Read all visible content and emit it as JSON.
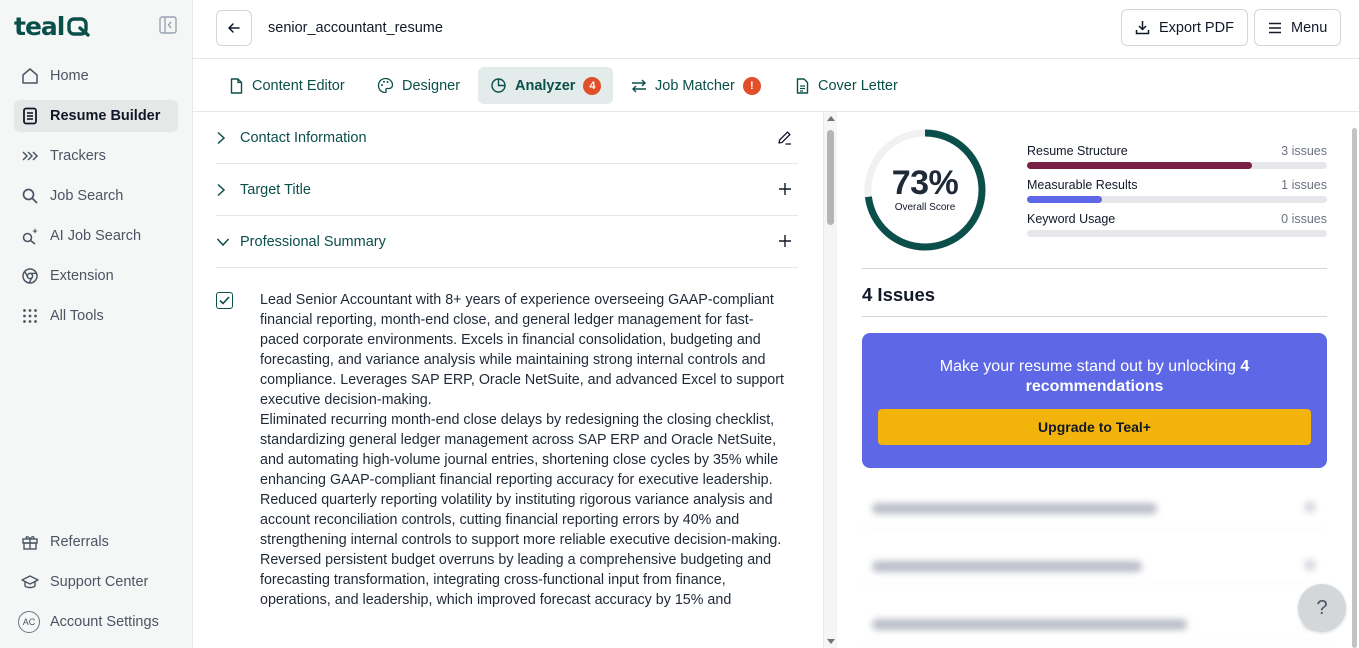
{
  "sidebar": {
    "logo": "teal",
    "nav_top": [
      {
        "label": "Home",
        "icon": "home-icon"
      },
      {
        "label": "Resume Builder",
        "icon": "document-icon",
        "active": true
      },
      {
        "label": "Trackers",
        "icon": "chevrons-right-icon"
      },
      {
        "label": "Job Search",
        "icon": "search-icon"
      },
      {
        "label": "AI Job Search",
        "icon": "ai-search-icon"
      },
      {
        "label": "Extension",
        "icon": "chrome-icon"
      },
      {
        "label": "All Tools",
        "icon": "grid-icon"
      }
    ],
    "nav_bottom": [
      {
        "label": "Referrals",
        "icon": "gift-icon"
      },
      {
        "label": "Support Center",
        "icon": "graduation-cap-icon"
      },
      {
        "label": "Account Settings",
        "icon": "avatar",
        "initials": "AC"
      }
    ]
  },
  "header": {
    "doc_title": "senior_accountant_resume",
    "export_label": "Export PDF",
    "menu_label": "Menu"
  },
  "tabs": [
    {
      "label": "Content Editor",
      "icon": "file-icon"
    },
    {
      "label": "Designer",
      "icon": "palette-icon"
    },
    {
      "label": "Analyzer",
      "icon": "pie-chart-icon",
      "badge": "4",
      "active": true
    },
    {
      "label": "Job Matcher",
      "icon": "arrows-icon",
      "badge": "!"
    },
    {
      "label": "Cover Letter",
      "icon": "file-text-icon"
    }
  ],
  "editor": {
    "sections": [
      {
        "label": "Contact Information",
        "expanded": false,
        "action": "edit"
      },
      {
        "label": "Target Title",
        "expanded": false,
        "action": "add"
      },
      {
        "label": "Professional Summary",
        "expanded": true,
        "action": "add"
      }
    ],
    "summary_checked": true,
    "summary_paragraphs": [
      "Lead Senior Accountant with 8+ years of experience overseeing GAAP-compliant financial reporting, month-end close, and general ledger management for fast-paced corporate environments. Excels in financial consolidation, budgeting and forecasting, and variance analysis while maintaining strong internal controls and compliance. Leverages SAP ERP, Oracle NetSuite, and advanced Excel to support executive decision-making.",
      "Eliminated recurring month-end close delays by redesigning the closing checklist, standardizing general ledger management across SAP ERP and Oracle NetSuite, and automating high-volume journal entries, shortening close cycles by 35% while enhancing GAAP-compliant financial reporting accuracy for executive leadership.",
      "Reduced quarterly reporting volatility by instituting rigorous variance analysis and account reconciliation controls, cutting financial reporting errors by 40% and strengthening internal controls to support more reliable executive decision-making.",
      "Reversed persistent budget overruns by leading a comprehensive budgeting and forecasting transformation, integrating cross-functional input from finance, operations, and leadership, which improved forecast accuracy by 15% and"
    ]
  },
  "analyzer": {
    "score_value": "73%",
    "score_fraction": 0.73,
    "score_label": "Overall Score",
    "metrics": [
      {
        "name": "Resume Structure",
        "count": "3 issues",
        "fill": 0.75,
        "color": "#7a1f45"
      },
      {
        "name": "Measurable Results",
        "count": "1 issues",
        "fill": 0.25,
        "color": "#5e67e6"
      },
      {
        "name": "Keyword Usage",
        "count": "0 issues",
        "fill": 0,
        "color": "#5e67e6"
      }
    ],
    "issues_title": "4 Issues",
    "upgrade": {
      "text_prefix": "Make your resume stand out by unlocking",
      "text_bold": "4 recommendations",
      "button_label": "Upgrade to Teal+"
    }
  },
  "help_label": "?",
  "colors": {
    "brand": "#0b4f4a",
    "accent": "#5e67e6",
    "badge": "#e04e2a",
    "upgrade_button": "#f2b40a"
  }
}
